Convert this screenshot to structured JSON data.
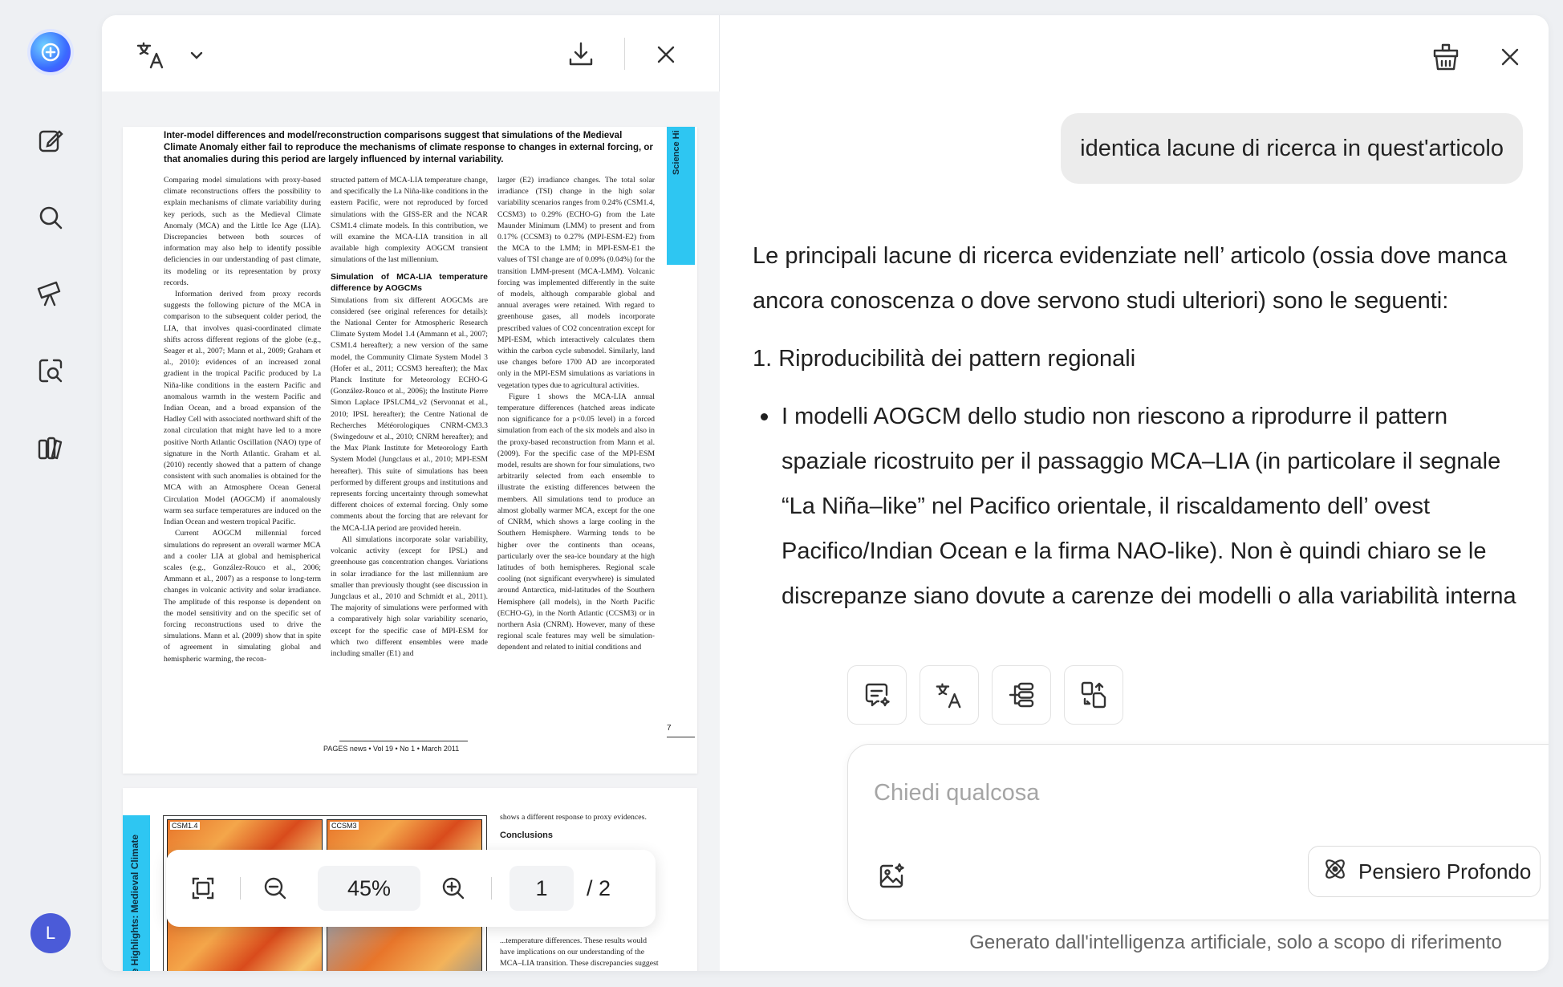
{
  "pdf": {
    "zoom": "45%",
    "page_current": "1",
    "page_total_label": "/ 2",
    "page1": {
      "headline": "Inter-model differences and model/reconstruction comparisons suggest that simulations of the Medieval Climate Anomaly either fail to reproduce the mechanisms of climate response to changes in external forcing, or that anomalies during this period are largely influenced by internal variability.",
      "side_tab": "Science Hi",
      "col1": [
        "Comparing model simulations with proxy-based climate reconstructions offers the possibility to explain mechanisms of climate variability during key periods, such as the Medieval Climate Anomaly (MCA) and the Little Ice Age (LIA). Discrepancies between both sources of information may also help to identify possible deficiencies in our understanding of past climate, its modeling or its representation by proxy records.",
        "Information derived from proxy records suggests the following picture of the MCA in comparison to the subsequent colder period, the LIA, that involves quasi-coordinated climate shifts across different regions of the globe (e.g., Seager et al., 2007; Mann et al., 2009; Graham et al., 2010): evidences of an increased zonal gradient in the tropical Pacific produced by La Niña-like conditions in the eastern Pacific and anomalous warmth in the western Pacific and Indian Ocean, and a broad expansion of the Hadley Cell with associated northward shift of the zonal circulation that might have led to a more positive North Atlantic Oscillation (NAO) type of signature in the North Atlantic. Graham et al. (2010) recently showed that a pattern of change consistent with such anomalies is obtained for the MCA with an Atmosphere Ocean General Circulation Model (AOGCM) if anomalously warm sea surface temperatures are induced on the Indian Ocean and western tropical Pacific.",
        "Current AOGCM millennial forced simulations do represent an overall warmer MCA and a cooler LIA at global and hemispherical scales (e.g., González-Rouco et al., 2006; Ammann et al., 2007) as a response to long-term changes in volcanic activity and solar irradiance. The amplitude of this response is dependent on the model sensitivity and on the specific set of forcing reconstructions used to drive the simulations. Mann et al. (2009) show that in spite of agreement in simulating global and hemispheric warming, the recon-"
      ],
      "col2_intro": "structed pattern of MCA-LIA temperature change, and specifically the La Niña-like conditions in the eastern Pacific, were not reproduced by forced simulations with the GISS-ER and the NCAR CSM1.4 climate models. In this contribution, we will examine the MCA-LIA transition in all available high complexity AOGCM transient simulations of the last millennium.",
      "col2_heading": "Simulation of MCA-LIA temperature difference by AOGCMs",
      "col2_body": [
        "Simulations from six different AOGCMs are considered (see original references for details): the National Center for Atmospheric Research Climate System Model 1.4 (Ammann et al., 2007; CSM1.4 hereafter); a new version of the same model, the Community Climate System Model 3 (Hofer et al., 2011; CCSM3 hereafter); the Max Planck Institute for Meteorology ECHO-G (González-Rouco et al., 2006); the Institute Pierre Simon Laplace IPSLCM4_v2 (Servonnat et al., 2010; IPSL hereafter); the Centre National de Recherches Météorologiques CNRM-CM3.3 (Swingedouw et al., 2010; CNRM hereafter); and the Max Plank Institute for Meteorology Earth System Model (Jungclaus et al., 2010; MPI-ESM hereafter). This suite of simulations has been performed by different groups and institutions and represents forcing uncertainty through somewhat different choices of external forcing. Only some comments about the forcing that are relevant for the MCA-LIA period are provided herein.",
        "All simulations incorporate solar variability, volcanic activity (except for IPSL) and greenhouse gas concentration changes. Variations in solar irradiance for the last millennium are smaller than previously thought (see discussion in Jungclaus et al., 2010 and Schmidt et al., 2011). The majority of simulations were performed with a comparatively high solar variability scenario, except for the specific case of MPI-ESM for which two different ensembles were made including smaller (E1) and"
      ],
      "col3": [
        "larger (E2) irradiance changes. The total solar irradiance (TSI) change in the high solar variability scenarios ranges from 0.24% (CSM1.4, CCSM3) to 0.29% (ECHO-G) from the Late Maunder Minimum (LMM) to present and from 0.17% (CCSM3) to 0.27% (MPI-ESM-E2) from the MCA to the LMM; in MPI-ESM-E1 the values of TSI change are of 0.09% (0.04%) for the transition LMM-present (MCA-LMM). Volcanic forcing was implemented differently in the suite of models, although comparable global and annual averages were retained. With regard to greenhouse gases, all models incorporate prescribed values of CO2 concentration except for MPI-ESM, which interactively calculates them within the carbon cycle submodel. Similarly, land use changes before 1700 AD are incorporated only in the MPI-ESM simulations as variations in vegetation types due to agricultural activities.",
        "Figure 1 shows the MCA-LIA annual temperature differences (hatched areas indicate non significance for a p<0.05 level) in a forced simulation from each of the six models and also in the proxy-based reconstruction from Mann et al. (2009). For the specific case of the MPI-ESM model, results are shown for four simulations, two arbitrarily selected from each ensemble to illustrate the existing differences between the members. All simulations tend to produce an almost globally warmer MCA, except for the one of CNRM, which shows a large cooling in the Southern Hemisphere. Warming tends to be higher over the continents than oceans, particularly over the sea-ice boundary at the high latitudes of both hemispheres. Regional scale cooling (not significant everywhere) is simulated around Antarctica, mid-latitudes of the Southern Hemisphere (all models), in the North Pacific (ECHO-G), in the North Atlantic (CCSM3) or in northern Asia (CNRM). However, many of these regional scale features may well be simulation-dependent and related to initial conditions and"
      ],
      "page_number": "7",
      "footer": "PAGES news • Vol 19 • No 1 • March 2011"
    },
    "page2": {
      "side_tab": "ence Highlights: Medieval Climate",
      "map1_label": "CSM1.4",
      "map2_label": "CCSM3",
      "text_top": "shows a different response to proxy evidences.",
      "heading": "Conclusions",
      "text_bottom": "...temperature differences. These results would have implications on our understanding of the MCA–LIA transition. These discrepancies suggest that either the MCA–LIA changes arose from internal"
    }
  },
  "chat": {
    "user_message": "identica lacune di ricerca in quest'articolo",
    "answer_intro": "Le principali lacune di ricerca evidenziate nell’ articolo (ossia dove manca ancora conoscenza o dove servono studi ulteriori) sono le seguenti:",
    "answer_item1_title": "1. Riproducibilità dei pattern regionali",
    "answer_item1_bullet": "I modelli AOGCM dello studio non riescono a riprodurre il pattern spaziale ricostruito per il passaggio MCA–LIA (in particolare il segnale “La Niña–like” nel Pacifico orientale, il riscaldamento dell’ ovest Pacifico/Indian Ocean e la firma NAO-like). Non è quindi chiaro se le discrepanze siano dovute a carenze dei modelli o alla variabilità interna",
    "input_placeholder": "Chiedi qualcosa",
    "deep_thinking_label": "Pensiero Profondo",
    "disclaimer": "Generato dall'intelligenza artificiale, solo a scopo di riferimento"
  },
  "user": {
    "avatar_initial": "L"
  },
  "colors": {
    "accent_tab": "#2ec6f2",
    "send_button": "#c7ccff",
    "avatar": "#4b5bd8"
  }
}
